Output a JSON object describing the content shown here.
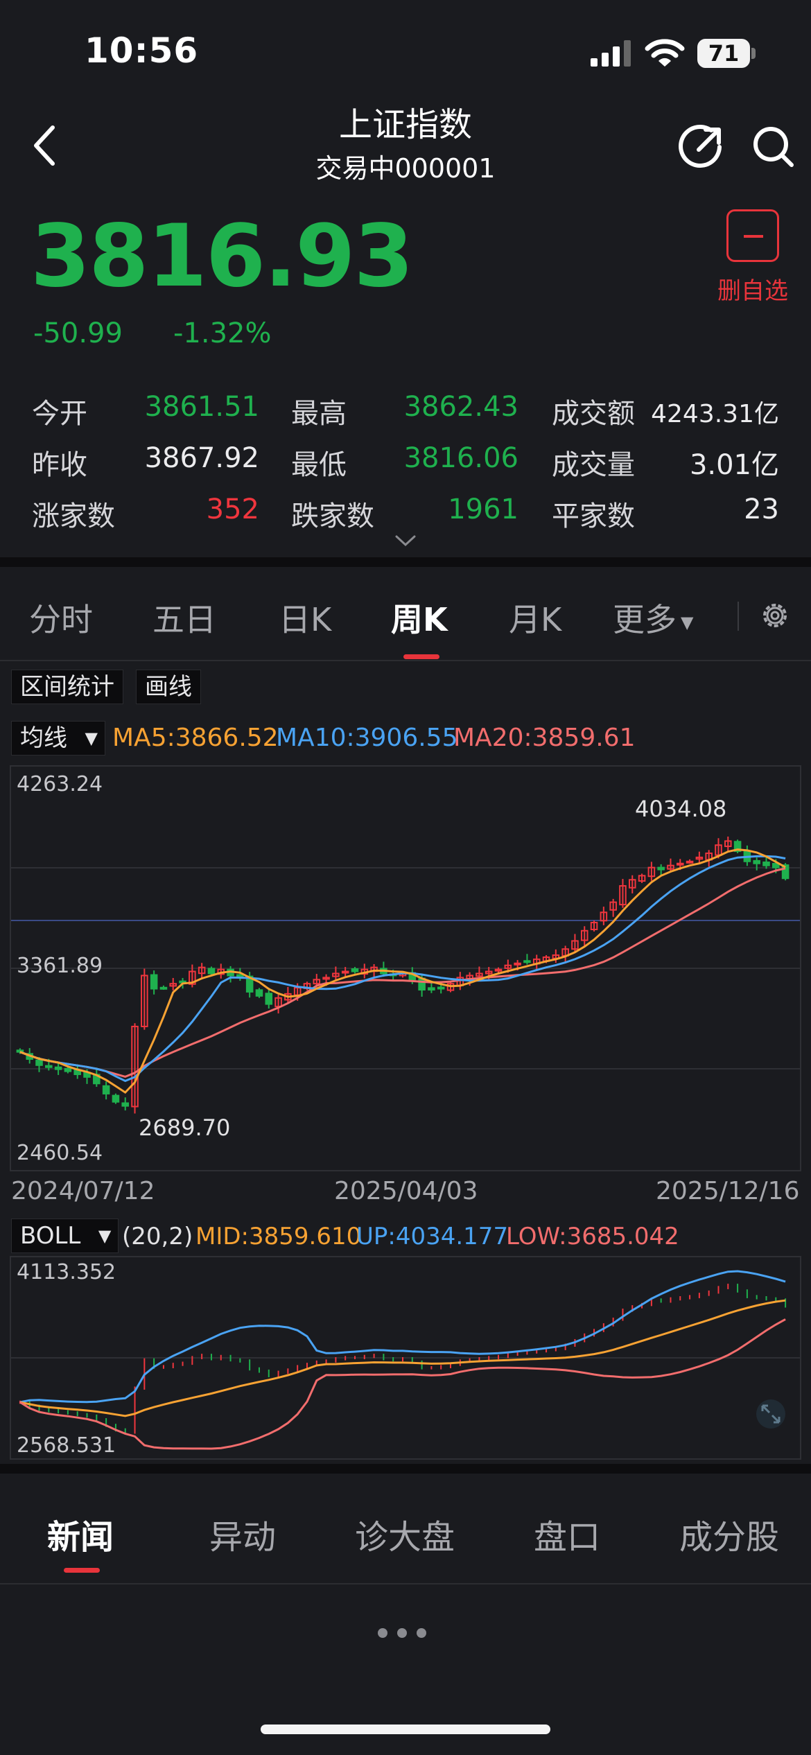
{
  "status": {
    "time": "10:56",
    "battery": "71"
  },
  "header": {
    "title": "上证指数",
    "subtitle": "交易中000001"
  },
  "quote": {
    "price": "3816.93",
    "change": "-50.99",
    "change_pct": "-1.32%",
    "watch_label": "删自选"
  },
  "stats": [
    [
      {
        "label": "今开",
        "value": "3861.51",
        "tone": "green"
      },
      {
        "label": "最高",
        "value": "3862.43",
        "tone": "green"
      },
      {
        "label": "成交额",
        "value": "4243.31亿",
        "tone": "white"
      }
    ],
    [
      {
        "label": "昨收",
        "value": "3867.92",
        "tone": "white"
      },
      {
        "label": "最低",
        "value": "3816.06",
        "tone": "green"
      },
      {
        "label": "成交量",
        "value": "3.01亿",
        "tone": "white"
      }
    ],
    [
      {
        "label": "涨家数",
        "value": "352",
        "tone": "red"
      },
      {
        "label": "跌家数",
        "value": "1961",
        "tone": "green"
      },
      {
        "label": "平家数",
        "value": "23",
        "tone": "white"
      }
    ]
  ],
  "tabs": [
    "分时",
    "五日",
    "日K",
    "周K",
    "月K",
    "更多"
  ],
  "active_tab": "周K",
  "tools": {
    "range_stats": "区间统计",
    "draw_line": "画线",
    "indicator": "均线",
    "sub_indicator": "BOLL"
  },
  "ma": {
    "ma5": "MA5:3866.52",
    "ma10": "MA10:3906.55",
    "ma20": "MA20:3859.61"
  },
  "chart_data": {
    "type": "candlestick",
    "interval": "weekly",
    "y_ticks": [
      "4263.24",
      "3361.89",
      "2460.54"
    ],
    "ylim": [
      2460.54,
      4263.24
    ],
    "high_label": "4034.08",
    "low_label": "2689.70",
    "x_ticks": [
      "2024/07/12",
      "2025/04/03",
      "2025/12/16"
    ],
    "colors": {
      "up": "#f0363e",
      "down": "#1fb14e",
      "ma5": "#f7a233",
      "ma10": "#4aa3f3",
      "ma20": "#f26d6d"
    },
    "close_approx": [
      2965,
      2930,
      2900,
      2890,
      2880,
      2870,
      2855,
      2842,
      2810,
      2760,
      2720,
      2700,
      3090,
      3340,
      3275,
      3280,
      3300,
      3310,
      3360,
      3380,
      3350,
      3370,
      3340,
      3330,
      3260,
      3240,
      3200,
      3230,
      3250,
      3280,
      3300,
      3320,
      3330,
      3350,
      3360,
      3360,
      3370,
      3380,
      3350,
      3340,
      3350,
      3320,
      3270,
      3270,
      3280,
      3300,
      3330,
      3340,
      3350,
      3360,
      3370,
      3390,
      3400,
      3410,
      3420,
      3430,
      3440,
      3470,
      3510,
      3560,
      3600,
      3650,
      3700,
      3780,
      3810,
      3830,
      3870,
      3860,
      3880,
      3890,
      3900,
      3920,
      3940,
      3980,
      4000,
      3950,
      3900,
      3890,
      3880,
      3870,
      3816.93
    ]
  },
  "boll": {
    "params": "(20,2)",
    "mid": "MID:3859.610",
    "up": "UP:4034.177",
    "low": "LOW:3685.042",
    "y_ticks": [
      "4113.352",
      "2568.531"
    ]
  },
  "bottom_tabs": [
    "新闻",
    "异动",
    "诊大盘",
    "盘口",
    "成分股"
  ],
  "active_bottom_tab": "新闻"
}
